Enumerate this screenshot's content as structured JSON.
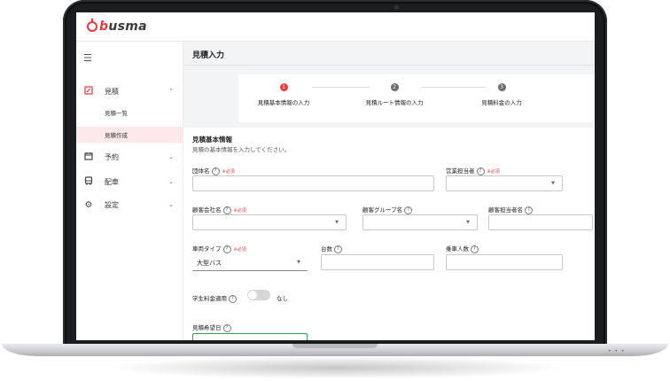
{
  "app": {
    "logo_b": "b",
    "logo_rest": "usma"
  },
  "sidebar": {
    "menu_icon": "menu-icon",
    "items": [
      {
        "label": "見積",
        "icon": "edit-icon",
        "chevron": "⌃"
      },
      {
        "label": "予約",
        "icon": "calendar-icon",
        "chevron": "⌄"
      },
      {
        "label": "配車",
        "icon": "bus-icon",
        "chevron": "⌄"
      },
      {
        "label": "設定",
        "icon": "gear-icon",
        "chevron": "⌄"
      }
    ],
    "sub_items": [
      {
        "label": "見積一覧"
      },
      {
        "label": "見積作成"
      }
    ]
  },
  "main": {
    "title": "見積入力",
    "steps": [
      {
        "number": "1",
        "label": "見積基本情報の入力"
      },
      {
        "number": "2",
        "label": "見積ルート情報の入力"
      },
      {
        "number": "3",
        "label": "見積料金の入力"
      }
    ],
    "section": {
      "title": "見積基本情報",
      "description": "見積の基本情報を入力してください。"
    },
    "fields": {
      "group_name": {
        "label": "団体名",
        "required": "※必須"
      },
      "sales_rep": {
        "label": "営業担当者",
        "required": "※必須"
      },
      "customer_company": {
        "label": "顧客会社名",
        "required": "※必須"
      },
      "customer_group": {
        "label": "顧客グループ名"
      },
      "customer_contact": {
        "label": "顧客担当者名"
      },
      "vehicle_type": {
        "label": "車両タイプ",
        "required": "※必須",
        "value": "大型バス"
      },
      "vehicle_count": {
        "label": "台数"
      },
      "passengers": {
        "label": "乗車人数"
      },
      "student_rate": {
        "label": "学生料金適用",
        "toggle_text": "なし"
      },
      "estimate_date": {
        "label": "見積希望日"
      }
    }
  },
  "colors": {
    "accent": "#e23b3b",
    "step_inactive": "#6b6b6b",
    "active_bg": "#fde9ea"
  }
}
